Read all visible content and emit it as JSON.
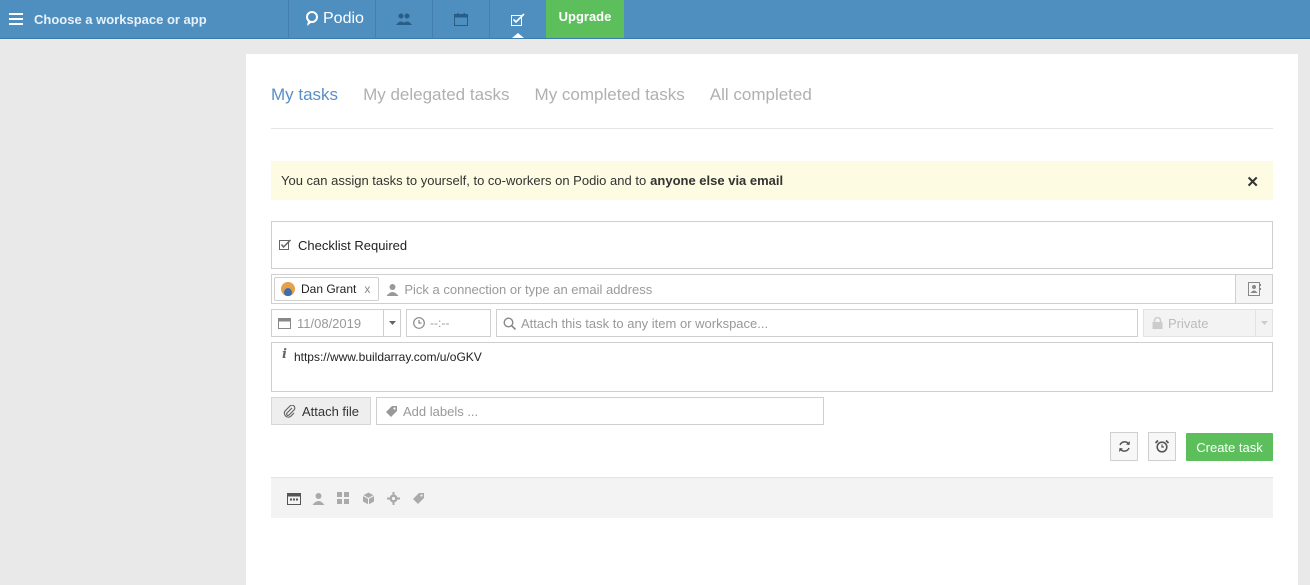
{
  "topbar": {
    "workspace_label": "Choose a workspace or app",
    "brand": "Podio",
    "upgrade_label": "Upgrade",
    "nav_icons": [
      "contacts-icon",
      "calendar-icon",
      "tasks-icon"
    ]
  },
  "tabs": [
    {
      "label": "My tasks",
      "active": true
    },
    {
      "label": "My delegated tasks",
      "active": false
    },
    {
      "label": "My completed tasks",
      "active": false
    },
    {
      "label": "All completed",
      "active": false
    }
  ],
  "notice": {
    "text": "You can assign tasks to yourself, to co-workers on Podio and to",
    "bold": "anyone else via email",
    "close_icon": "close-icon"
  },
  "task": {
    "title": "Checklist Required",
    "assignee": {
      "name": "Dan Grant",
      "remove": "x"
    },
    "assignee_placeholder": "Pick a connection or type an email address",
    "due_date": "11/08/2019",
    "due_time_placeholder": "--:--",
    "attach_placeholder": "Attach this task to any item or workspace...",
    "privacy": "Private",
    "description": "https://www.buildarray.com/u/oGKV",
    "attach_file_label": "Attach file",
    "labels_placeholder": "Add labels ...",
    "create_label": "Create task"
  },
  "footer_icons": [
    "calendar-icon",
    "person-icon",
    "grid-icon",
    "cube-icon",
    "gear-icon",
    "tag-icon"
  ],
  "colors": {
    "topbar": "#4f8fc0",
    "accent_green": "#5cbf5c",
    "active_tab": "#5a8fc4",
    "notice_bg": "#fdfbe1"
  }
}
